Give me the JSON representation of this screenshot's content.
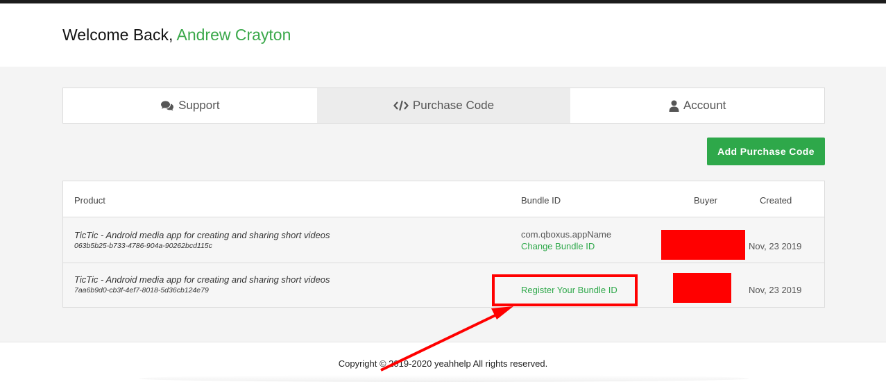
{
  "header": {
    "greeting": "Welcome Back,",
    "user_name": "Andrew Crayton"
  },
  "tabs": [
    {
      "label": "Support",
      "icon": "comments-icon",
      "active": false
    },
    {
      "label": "Purchase Code",
      "icon": "code-icon",
      "active": true
    },
    {
      "label": "Account",
      "icon": "user-icon",
      "active": false
    }
  ],
  "actions": {
    "add_purchase_code": "Add Purchase Code"
  },
  "table": {
    "columns": [
      "Product",
      "Bundle ID",
      "Buyer",
      "Created"
    ],
    "rows": [
      {
        "product": "TicTic - Android media app for creating and sharing short videos",
        "code": "063b5b25-b733-4786-904a-90262bcd115c",
        "bundle_id": "com.qboxus.appName",
        "bundle_action": "Change Bundle ID",
        "created": "Nov, 23 2019"
      },
      {
        "product": "TicTic - Android media app for creating and sharing short videos",
        "code": "7aa6b9d0-cb3f-4ef7-8018-5d36cb124e79",
        "bundle_id": "",
        "bundle_action": "Register Your Bundle ID",
        "created": "Nov, 23 2019"
      }
    ]
  },
  "footer": {
    "copyright": "Copyright © 2019-2020 yeahhelp All rights reserved."
  },
  "colors": {
    "accent": "#2ea84a",
    "annotation": "#ff0000"
  }
}
